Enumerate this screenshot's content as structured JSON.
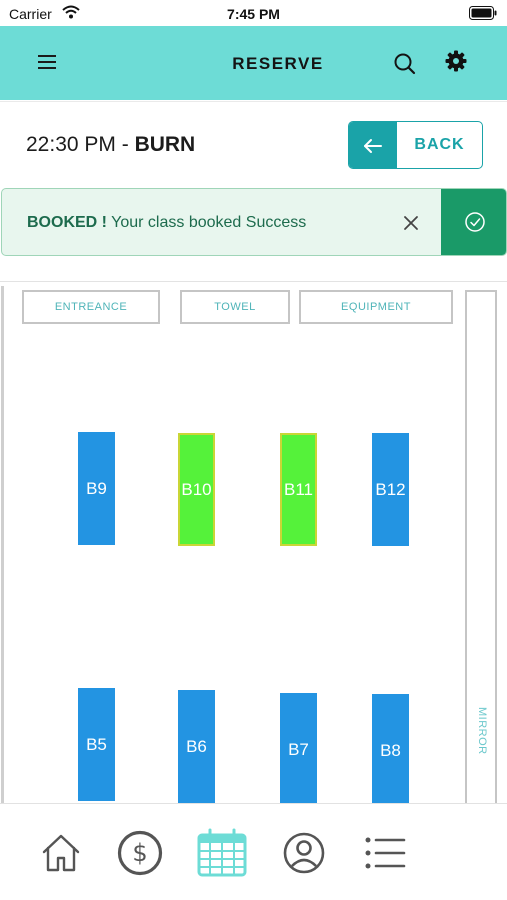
{
  "status_bar": {
    "carrier": "Carrier",
    "time": "7:45 PM"
  },
  "header": {
    "title": "RESERVE",
    "icons": [
      "menu-icon",
      "search-icon",
      "gear-icon"
    ]
  },
  "class_info": {
    "time": "22:30 PM - ",
    "name": "BURN"
  },
  "back_button": {
    "label": "BACK"
  },
  "alert": {
    "title": "BOOKED !",
    "message": " Your class booked Success"
  },
  "studio": {
    "zones": [
      "ENTREANCE",
      "TOWEL",
      "EQUIPMENT"
    ],
    "mirror_label": "MIRROR",
    "bikes": [
      {
        "label": "B9",
        "status": "available"
      },
      {
        "label": "B10",
        "status": "booked"
      },
      {
        "label": "B11",
        "status": "booked"
      },
      {
        "label": "B12",
        "status": "available"
      },
      {
        "label": "B5",
        "status": "available"
      },
      {
        "label": "B6",
        "status": "available"
      },
      {
        "label": "B7",
        "status": "available"
      },
      {
        "label": "B8",
        "status": "available"
      }
    ]
  },
  "bottom_nav": {
    "items": [
      "home-icon",
      "dollar-icon",
      "calendar-icon",
      "profile-icon",
      "list-icon"
    ],
    "active": "calendar-icon"
  },
  "colors": {
    "header_bg": "#6ddcd6",
    "accent": "#1aa3a8",
    "success": "#1a9a68",
    "bike_available": "#2394e2",
    "bike_booked": "#55f23a"
  }
}
